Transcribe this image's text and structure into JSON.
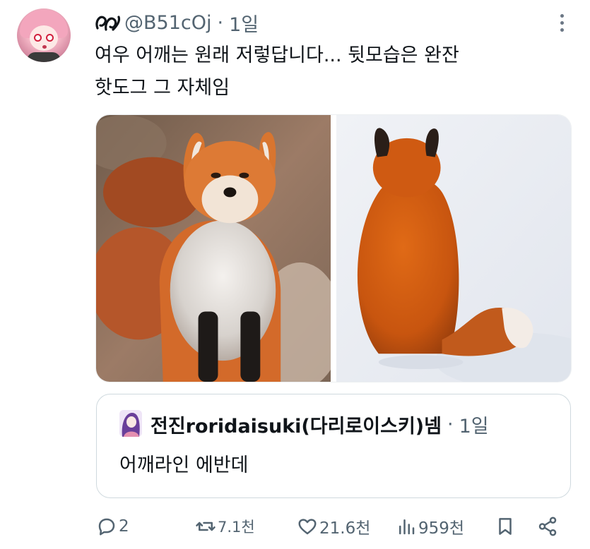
{
  "tweet": {
    "handle": "@B51cOj",
    "separator": "·",
    "time": "1일",
    "text_line1": "여우 어깨는 원래 저렇답니다... 뒷모습은 완잔",
    "text_line2": "핫도그 그 자체임"
  },
  "quote": {
    "name": "전진roridaisuki(다리로이스키)넴",
    "separator": "·",
    "time": "1일",
    "text": "어깨라인 에반데"
  },
  "actions": {
    "replies": "2",
    "retweets": "7.1천",
    "likes": "21.6천",
    "views": "959천"
  },
  "icons": {
    "reply": "reply-icon",
    "retweet": "retweet-icon",
    "like": "heart-icon",
    "views": "views-icon",
    "bookmark": "bookmark-icon",
    "share": "share-icon",
    "more": "more-icon"
  },
  "colors": {
    "text": "#0f1419",
    "secondary": "#536471",
    "border": "#cfd9de"
  }
}
